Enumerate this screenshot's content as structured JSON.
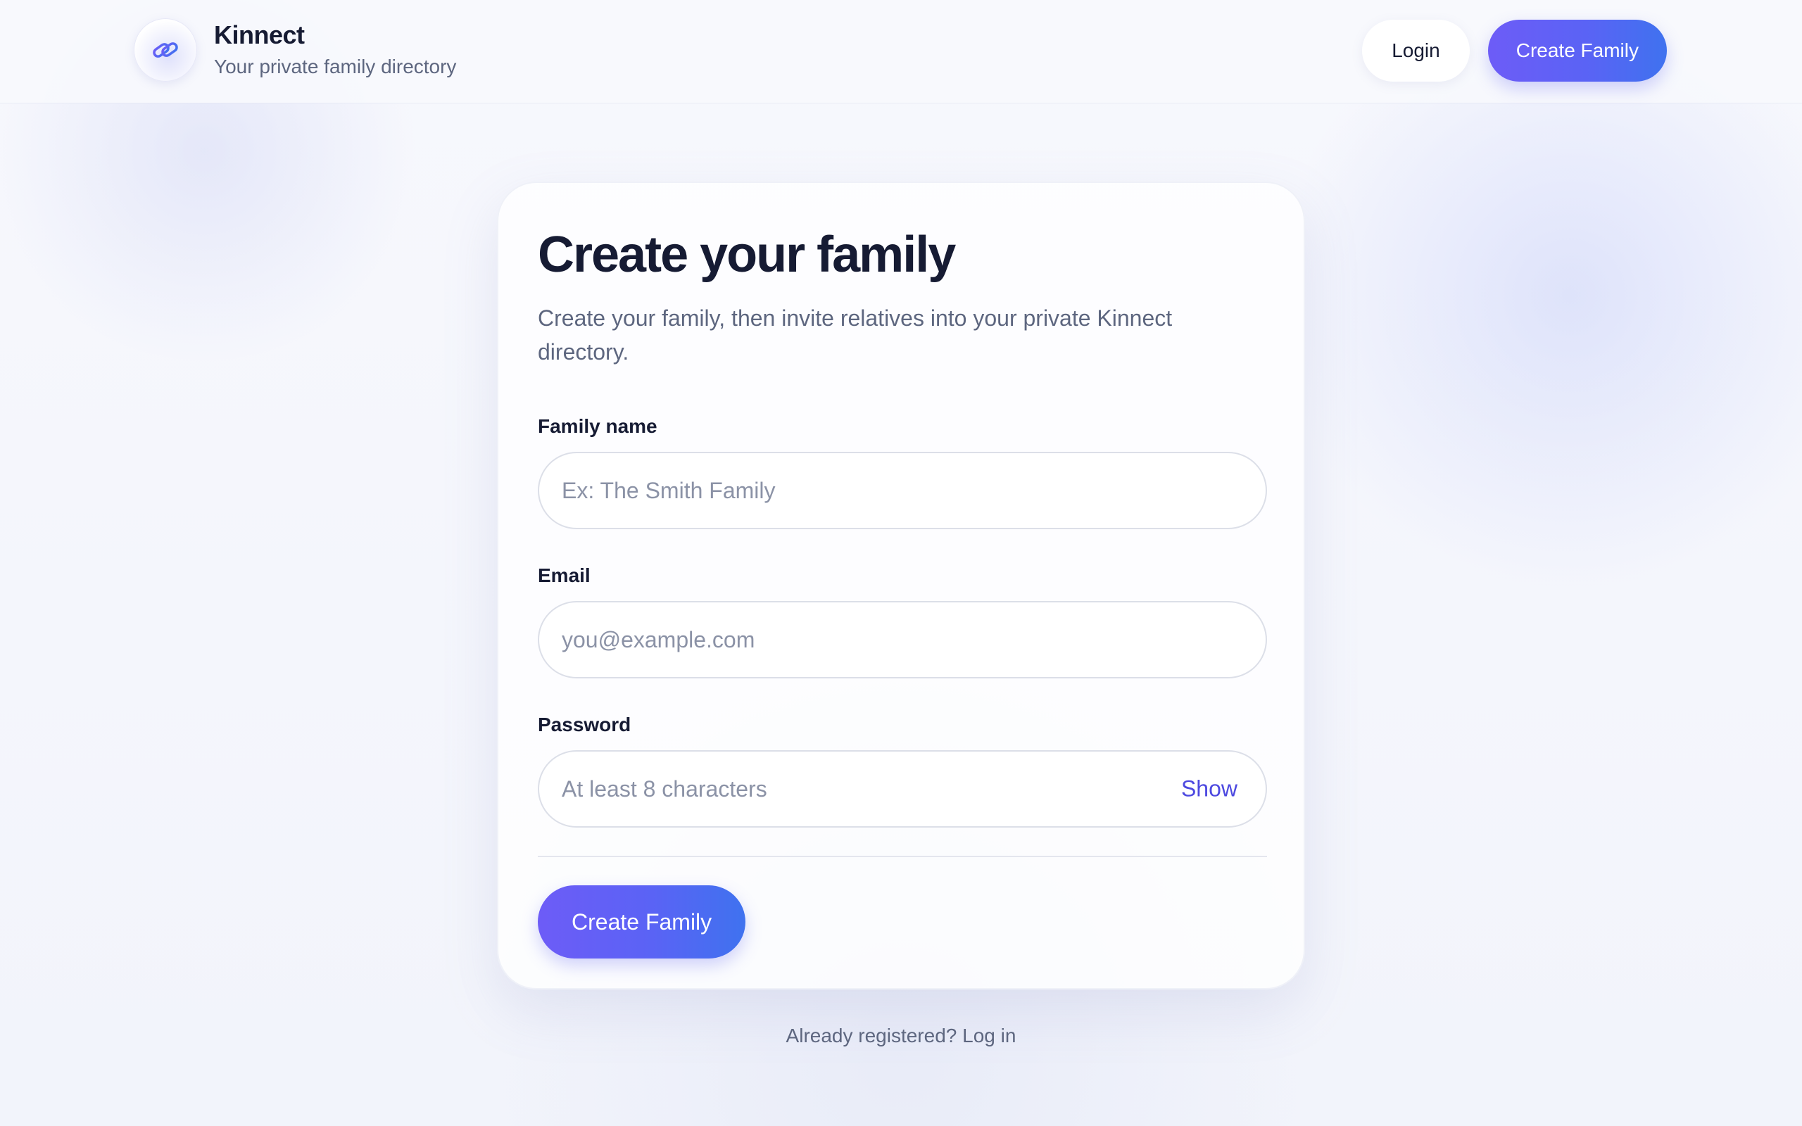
{
  "brand": {
    "title": "Kinnect",
    "subtitle": "Your private family directory",
    "logo_icon": "link-chain-icon"
  },
  "nav": {
    "login_label": "Login",
    "create_family_label": "Create Family"
  },
  "form": {
    "title": "Create your family",
    "description": "Create your family, then invite relatives into your private Kinnect directory.",
    "family_name": {
      "label": "Family name",
      "placeholder": "Ex: The Smith Family",
      "value": ""
    },
    "email": {
      "label": "Email",
      "placeholder": "you@example.com",
      "value": ""
    },
    "password": {
      "label": "Password",
      "placeholder": "At least 8 characters",
      "value": "",
      "toggle_label": "Show"
    },
    "submit_label": "Create Family"
  },
  "footer": {
    "prompt": "Already registered?",
    "login_link": "Log in"
  },
  "colors": {
    "accent_start": "#6d5cf7",
    "accent_end": "#3f72ef",
    "link": "#4d49e0",
    "text_primary": "#161b33",
    "text_muted": "#5d667f"
  }
}
